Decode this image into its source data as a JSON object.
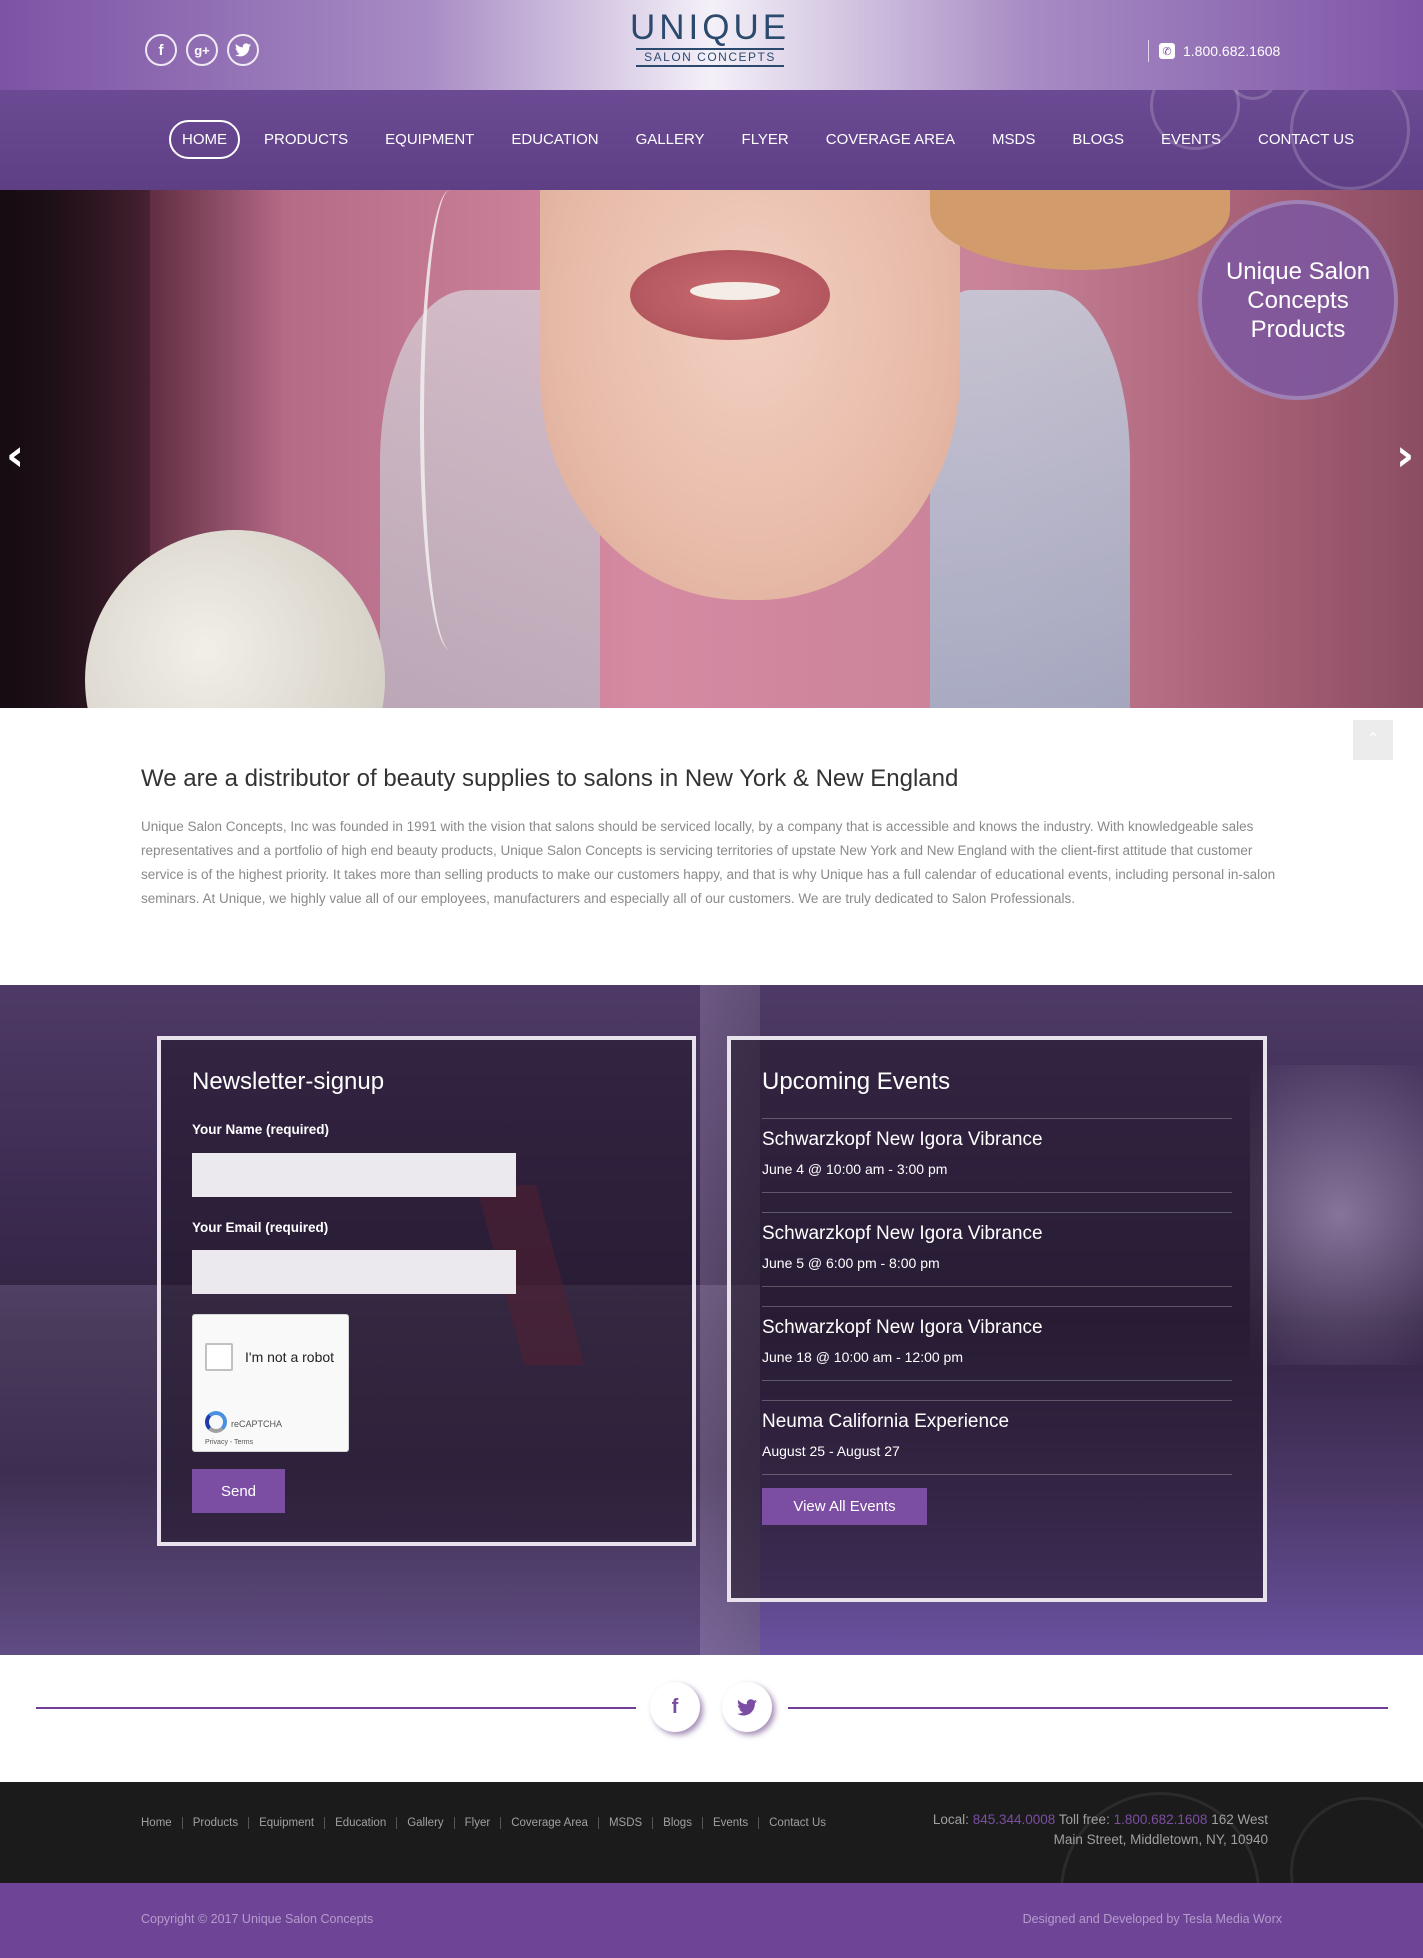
{
  "header": {
    "social": [
      {
        "icon": "facebook-icon",
        "glyph": "f"
      },
      {
        "icon": "google-plus-icon",
        "glyph": "g+"
      },
      {
        "icon": "twitter-icon",
        "glyph": "t"
      }
    ],
    "logo_main": "UNIQUE",
    "logo_sub": "SALON CONCEPTS",
    "phone": "1.800.682.1608"
  },
  "nav": {
    "items": [
      "HOME",
      "PRODUCTS",
      "EQUIPMENT",
      "EDUCATION",
      "GALLERY",
      "FLYER",
      "COVERAGE AREA",
      "MSDS",
      "BLOGS",
      "EVENTS",
      "CONTACT US"
    ],
    "active": "HOME"
  },
  "hero": {
    "badge": "Unique Salon Concepts Products",
    "prev_glyph": "‹",
    "next_glyph": "›"
  },
  "intro": {
    "heading": "We are a distributor of beauty supplies to salons in New York & New England",
    "body": "Unique Salon Concepts, Inc was founded in 1991 with the vision that salons should be serviced locally, by a company that is accessible and knows the industry. With knowledgeable sales representatives and a portfolio of high end beauty products, Unique Salon Concepts is servicing territories of upstate New York and New England with the client-first attitude that customer service is of the highest priority. It takes more than selling products to make our customers happy, and that is why Unique has a full calendar of educational events, including personal in-salon seminars. At Unique, we highly value all of our employees, manufacturers and especially all of our customers. We are truly dedicated to Salon Professionals."
  },
  "newsletter": {
    "title": "Newsletter-signup",
    "name_label": "Your Name (required)",
    "name_value": "",
    "email_label": "Your Email (required)",
    "email_value": "",
    "captcha_text": "I'm not a robot",
    "captcha_brand": "reCAPTCHA",
    "captcha_links": "Privacy - Terms",
    "send_label": "Send"
  },
  "events": {
    "title": "Upcoming Events",
    "items": [
      {
        "title": "Schwarzkopf New Igora Vibrance",
        "date": "June 4 @ 10:00 am - 3:00 pm"
      },
      {
        "title": "Schwarzkopf New Igora Vibrance",
        "date": "June 5 @ 6:00 pm - 8:00 pm"
      },
      {
        "title": "Schwarzkopf New Igora Vibrance",
        "date": "June 18 @ 10:00 am - 12:00 pm"
      },
      {
        "title": "Neuma California Experience",
        "date": "August 25 - August 27"
      }
    ],
    "view_all": "View All Events"
  },
  "social_strip": [
    {
      "icon": "facebook-icon",
      "glyph": "f"
    },
    {
      "icon": "twitter-icon",
      "glyph": "t"
    }
  ],
  "footer": {
    "links": [
      "Home",
      "Products",
      "Equipment",
      "Education",
      "Gallery",
      "Flyer",
      "Coverage Area",
      "MSDS",
      "Blogs",
      "Events",
      "Contact Us"
    ],
    "local_label": "Local:",
    "local_phone": "845.344.0008",
    "tollfree_label": "Toll free:",
    "tollfree_phone": "1.800.682.1608",
    "address_1": "162 West",
    "address_2": "Main Street, Middletown, NY, 10940",
    "copyright": "Copyright © 2017 Unique Salon Concepts",
    "developer": "Designed and Developed by Tesla Media Worx"
  },
  "colors": {
    "brand_purple": "#7b4ea3",
    "nav_purple": "#5e3f85",
    "footer_dark": "#1b1b1b",
    "footer_purple": "#6e4496"
  }
}
